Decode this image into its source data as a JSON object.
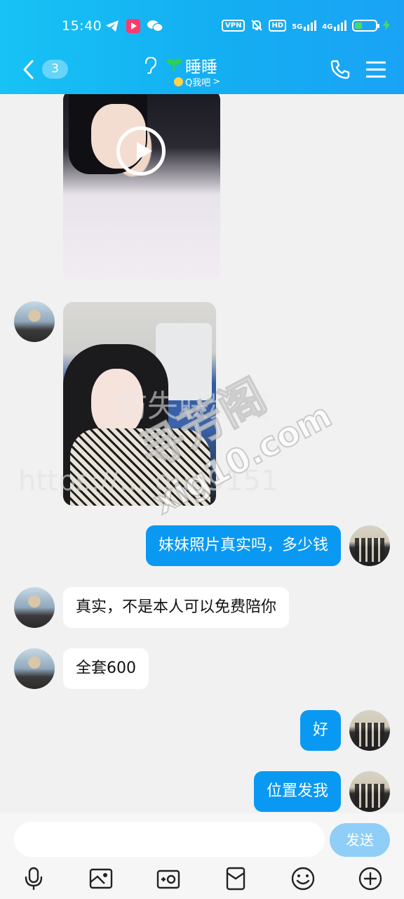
{
  "status_bar": {
    "time": "15:40",
    "vpn_label": "VPN",
    "hd_label": "HD",
    "network_1": "5G",
    "network_2": "4G",
    "battery_level": 0.35
  },
  "header": {
    "unread_count": "3",
    "contact_name": "睡睡",
    "online_status": "Q我吧",
    "status_chevron": ">"
  },
  "watermarks": {
    "line1": "防失联频道",
    "line2": "https://... gua9151",
    "brand": "寻芳阁",
    "domain": "xig10.com"
  },
  "messages": [
    {
      "direction": "incoming",
      "type": "video"
    },
    {
      "direction": "incoming",
      "type": "photo"
    },
    {
      "direction": "outgoing",
      "text": "妹妹照片真实吗，多少钱"
    },
    {
      "direction": "incoming",
      "text": "真实，不是本人可以免费陪你"
    },
    {
      "direction": "incoming",
      "text": "全套600"
    },
    {
      "direction": "outgoing",
      "text": "好"
    },
    {
      "direction": "outgoing",
      "text": "位置发我"
    }
  ],
  "input": {
    "placeholder": "",
    "send_label": "发送"
  },
  "toolbar": [
    "voice-icon",
    "image-icon",
    "camera-icon",
    "red-packet-icon",
    "emoji-icon",
    "plus-icon"
  ],
  "colors": {
    "header_bg": "#14aef2",
    "outgoing_bubble": "#0a99f2",
    "incoming_bubble": "#ffffff",
    "send_button": "#8fcef7",
    "chat_bg": "#f1f1f1"
  }
}
